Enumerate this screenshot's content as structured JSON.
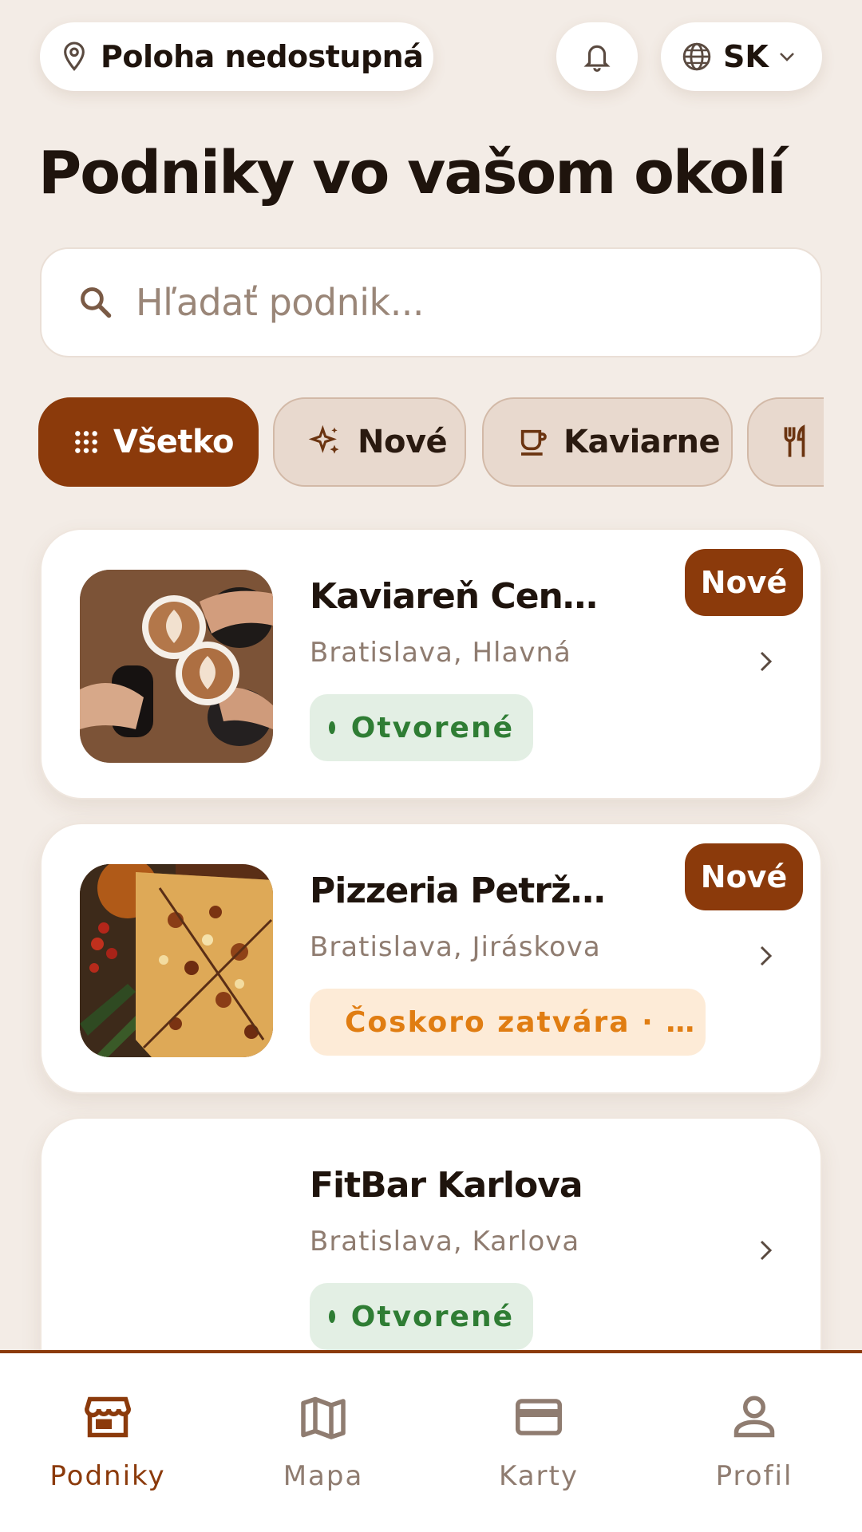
{
  "topbar": {
    "location_label": "Poloha nedostupná",
    "language": "SK",
    "icons": {
      "location": "map-pin-icon",
      "notifications": "bell-icon",
      "language": "globe-icon",
      "dropdown": "chevron-down-icon"
    }
  },
  "page": {
    "title": "Podniky vo vašom okolí"
  },
  "search": {
    "placeholder": "Hľadať podnik..."
  },
  "filters": [
    {
      "label": "Všetko",
      "icon": "grid-dots-icon",
      "active": true
    },
    {
      "label": "Nové",
      "icon": "sparkles-icon",
      "active": false
    },
    {
      "label": "Kaviarne",
      "icon": "coffee-cup-icon",
      "active": false
    },
    {
      "label": "",
      "icon": "utensils-icon",
      "active": false
    }
  ],
  "venues": [
    {
      "name": "Kaviareň Cen…",
      "address": "Bratislava, Hlavná",
      "status": "Otvorené",
      "status_type": "open",
      "badge": "Nové"
    },
    {
      "name": "Pizzeria Petrž…",
      "address": "Bratislava, Jiráskova",
      "status": "Čoskoro zatvára · …",
      "status_type": "closing",
      "badge": "Nové"
    },
    {
      "name": "FitBar Karlova",
      "address": "Bratislava, Karlova",
      "status": "Otvorené",
      "status_type": "open",
      "badge": ""
    }
  ],
  "nav": [
    {
      "label": "Podniky",
      "icon": "store-icon",
      "active": true
    },
    {
      "label": "Mapa",
      "icon": "map-icon",
      "active": false
    },
    {
      "label": "Karty",
      "icon": "credit-card-icon",
      "active": false
    },
    {
      "label": "Profil",
      "icon": "user-icon",
      "active": false
    }
  ],
  "colors": {
    "background": "#f3ece6",
    "accent": "#8b3a0b",
    "open": "#2f7d34",
    "closing": "#e07d12"
  }
}
